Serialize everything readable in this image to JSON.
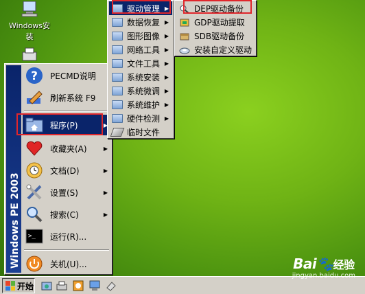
{
  "desktop": {
    "icons": [
      {
        "label": "Windows安装"
      },
      {
        "label": ""
      }
    ]
  },
  "start_menu": {
    "sidebar_text": "Windows PE 2003",
    "items": [
      {
        "label": "PECMD说明",
        "icon": "help-icon"
      },
      {
        "label": "刷新系统 F9",
        "icon": "pencil-icon"
      },
      {
        "label": "程序(P)",
        "icon": "programs-folder-icon",
        "has_submenu": true
      },
      {
        "label": "收藏夹(A)",
        "icon": "favorites-heart-icon",
        "has_submenu": true
      },
      {
        "label": "文档(D)",
        "icon": "documents-icon",
        "has_submenu": true
      },
      {
        "label": "设置(S)",
        "icon": "settings-tools-icon",
        "has_submenu": true
      },
      {
        "label": "搜索(C)",
        "icon": "search-magnifier-icon",
        "has_submenu": true
      },
      {
        "label": "运行(R)...",
        "icon": "run-console-icon"
      },
      {
        "label": "关机(U)...",
        "icon": "shutdown-icon"
      }
    ]
  },
  "programs_menu": {
    "items": [
      {
        "label": "驱动管理",
        "has_submenu": true
      },
      {
        "label": "数据恢复",
        "has_submenu": true
      },
      {
        "label": "图形图像",
        "has_submenu": true
      },
      {
        "label": "网络工具",
        "has_submenu": true
      },
      {
        "label": "文件工具",
        "has_submenu": true
      },
      {
        "label": "系统安装",
        "has_submenu": true
      },
      {
        "label": "系统微调",
        "has_submenu": true
      },
      {
        "label": "系统维护",
        "has_submenu": true
      },
      {
        "label": "硬件检测",
        "has_submenu": true
      },
      {
        "label": "临时文件",
        "has_submenu": false
      }
    ]
  },
  "driver_menu": {
    "items": [
      {
        "label": "DEP驱动备份"
      },
      {
        "label": "GDP驱动提取"
      },
      {
        "label": "SDB驱动备份"
      },
      {
        "label": "安装自定义驱动"
      }
    ]
  },
  "taskbar": {
    "start_label": "开始",
    "quick_launch": [
      "explorer-icon",
      "printer-icon",
      "image-viewer-icon",
      "monitor-icon",
      "eraser-icon"
    ]
  },
  "watermark": {
    "brand": "Bai",
    "brand_cn": "经验",
    "url": "jingyan.baidu.com"
  },
  "colors": {
    "highlight": "#0a246a",
    "annotation": "#e0262b",
    "menu_bg": "#d4d0c8"
  }
}
